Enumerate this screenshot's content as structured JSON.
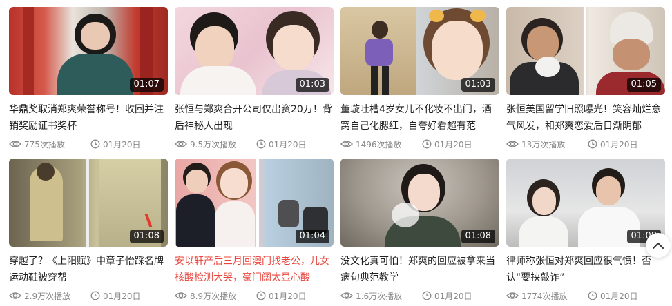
{
  "videos": [
    {
      "title": "华鼎奖取消郑爽荣誉称号！收回并注销奖励证书奖杯",
      "duration": "01:07",
      "views": "775次播放",
      "date": "01月20日",
      "highlight": false
    },
    {
      "title": "张恒与郑爽合开公司仅出资20万！背后神秘人出现",
      "duration": "01:03",
      "views": "9.5万次播放",
      "date": "01月20日",
      "highlight": false
    },
    {
      "title": "董璇吐槽4岁女儿不化妆不出门，酒窝自己化腮红，自夸好看超有范",
      "duration": "01:03",
      "views": "1496次播放",
      "date": "01月20日",
      "highlight": false
    },
    {
      "title": "张恒美国留学旧照曝光！笑容灿烂意气风发，和郑爽恋爱后日渐阴郁",
      "duration": "01:05",
      "views": "13万次播放",
      "date": "01月20日",
      "highlight": false
    },
    {
      "title": "穿越了？《上阳赋》中章子怡踩名牌运动鞋被穿帮",
      "duration": "01:08",
      "views": "2.9万次播放",
      "date": "01月20日",
      "highlight": false
    },
    {
      "title": "安以轩产后三月回澳门找老公，儿女核酸检测大哭，豪门阔太显心酸",
      "duration": "01:04",
      "views": "8.9万次播放",
      "date": "01月20日",
      "highlight": true
    },
    {
      "title": "没文化真可怕！郑爽的回应被拿来当病句典范教学",
      "duration": "01:08",
      "views": "1.6万次播放",
      "date": "01月20日",
      "highlight": false
    },
    {
      "title": "律师称张恒对郑爽回应很气愤！否认“要挟敲诈”",
      "duration": "01:08",
      "views": "1774次播放",
      "date": "01月20日",
      "highlight": false
    }
  ],
  "colors": {
    "highlight": "#e8443c",
    "meta": "#888888"
  },
  "icons": {
    "views": "eye-icon",
    "date": "clock-icon",
    "scroll": "chevron-up-icon"
  }
}
